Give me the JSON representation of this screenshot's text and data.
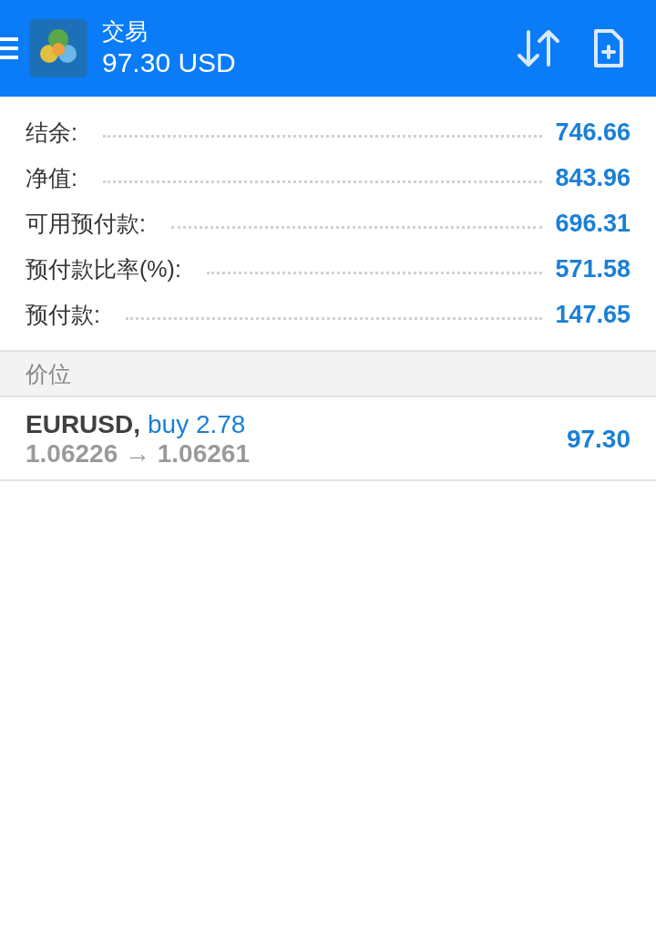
{
  "header": {
    "title": "交易",
    "balance": "97.30 USD"
  },
  "summary": [
    {
      "label": "结余:",
      "value": "746.66"
    },
    {
      "label": "净值:",
      "value": "843.96"
    },
    {
      "label": "可用预付款:",
      "value": "696.31"
    },
    {
      "label": "预付款比率(%):",
      "value": "571.58"
    },
    {
      "label": "预付款:",
      "value": "147.65"
    }
  ],
  "positions_section": {
    "title": "价位"
  },
  "positions": [
    {
      "symbol": "EURUSD,",
      "order": "buy 2.78",
      "prices": "1.06226 → 1.06261",
      "profit": "97.30"
    }
  ]
}
